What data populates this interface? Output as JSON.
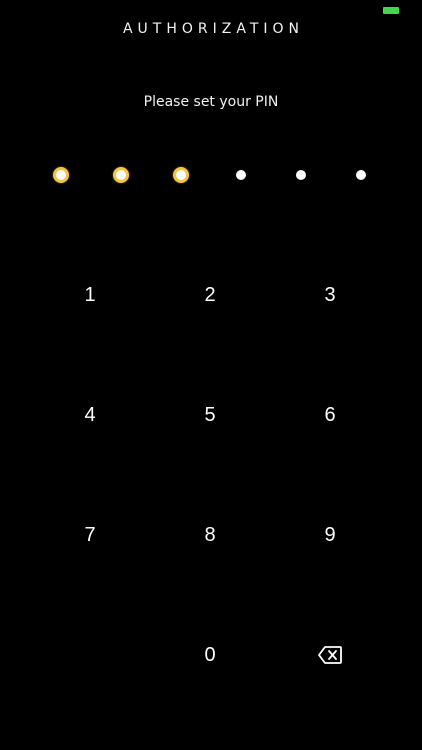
{
  "header": {
    "title": "AUTHORIZATION"
  },
  "status_bar": {
    "battery_color": "#3dd84f"
  },
  "prompt": {
    "text": "Please set your PIN"
  },
  "pin": {
    "length": 6,
    "entered": 3,
    "filled_color": "#f4c544"
  },
  "keypad": {
    "keys": [
      "1",
      "2",
      "3",
      "4",
      "5",
      "6",
      "7",
      "8",
      "9",
      "0"
    ],
    "backspace_icon": "backspace-icon"
  }
}
